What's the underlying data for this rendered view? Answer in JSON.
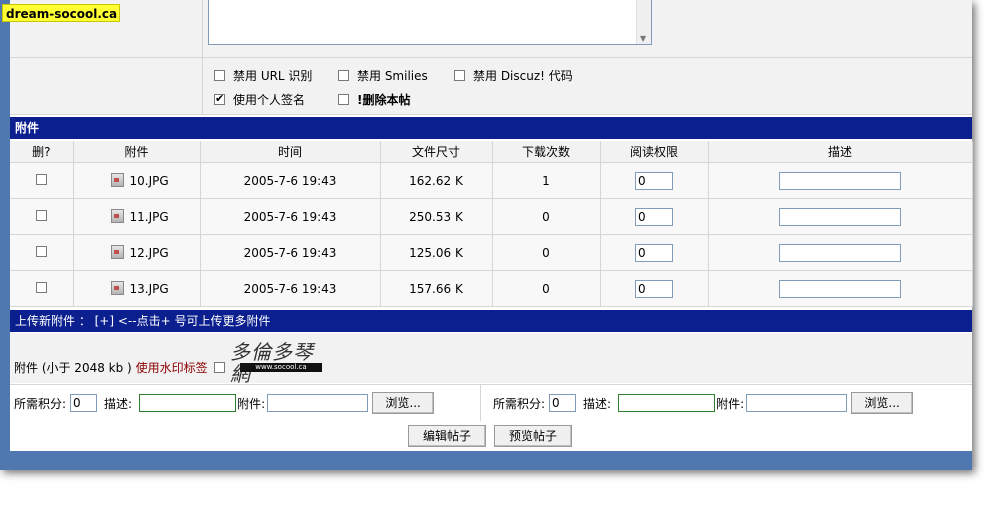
{
  "site_badge": "dream-socool.ca",
  "options": {
    "disable_url": "禁用 URL 识别",
    "disable_smilies": "禁用 Smilies",
    "disable_discuz": "禁用 Discuz! 代码",
    "use_signature": "使用个人签名",
    "delete_post": "!删除本帖",
    "use_signature_checked": true
  },
  "attachments_section": {
    "title": "附件",
    "headers": [
      "删?",
      "附件",
      "时间",
      "文件尺寸",
      "下载次数",
      "阅读权限",
      "描述"
    ],
    "rows": [
      {
        "name": "10.JPG",
        "time": "2005-7-6 19:43",
        "size": "162.62 K",
        "downloads": "1",
        "permission": "0",
        "description": ""
      },
      {
        "name": "11.JPG",
        "time": "2005-7-6 19:43",
        "size": "250.53 K",
        "downloads": "0",
        "permission": "0",
        "description": ""
      },
      {
        "name": "12.JPG",
        "time": "2005-7-6 19:43",
        "size": "125.06 K",
        "downloads": "0",
        "permission": "0",
        "description": ""
      },
      {
        "name": "13.JPG",
        "time": "2005-7-6 19:43",
        "size": "157.66 K",
        "downloads": "0",
        "permission": "0",
        "description": ""
      }
    ]
  },
  "upload_section": {
    "title": "上传新附件 ： [+] <--点击+ 号可上传更多附件",
    "size_limit": "附件 (小于 2048 kb )",
    "watermark_label": "使用水印标签",
    "watermark_logo_text": "多倫多琴網",
    "watermark_logo_url": "www.socool.ca"
  },
  "upload_fields": [
    {
      "points_label": "所需积分:",
      "points_value": "0",
      "desc_label": "描述:",
      "file_label": "附件:",
      "browse_label": "浏览..."
    },
    {
      "points_label": "所需积分:",
      "points_value": "0",
      "desc_label": "描述:",
      "file_label": "附件:",
      "browse_label": "浏览..."
    }
  ],
  "buttons": {
    "edit": "编辑帖子",
    "preview": "预览帖子"
  }
}
